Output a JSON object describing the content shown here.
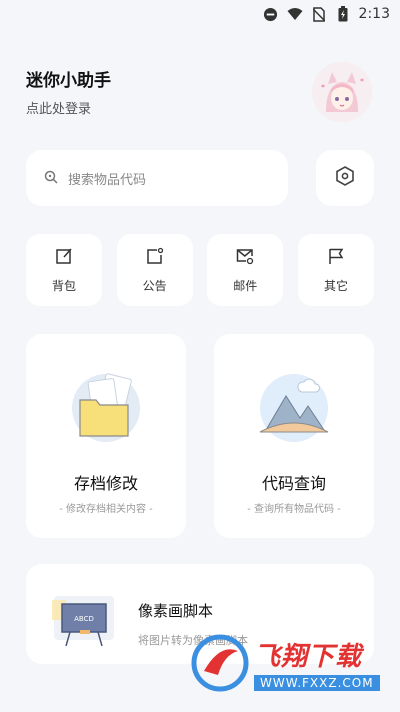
{
  "status_bar": {
    "time": "2:13"
  },
  "header": {
    "title": "迷你小助手",
    "login_text": "点此处登录"
  },
  "search": {
    "placeholder": "搜索物品代码"
  },
  "quick_actions": [
    {
      "label": "背包",
      "icon": "edit-icon"
    },
    {
      "label": "公告",
      "icon": "notice-icon"
    },
    {
      "label": "邮件",
      "icon": "mail-icon"
    },
    {
      "label": "其它",
      "icon": "flag-icon"
    }
  ],
  "cards": {
    "save_edit": {
      "title": "存档修改",
      "subtitle": "- 修改存档相关内容 -"
    },
    "code_query": {
      "title": "代码查询",
      "subtitle": "- 查询所有物品代码 -"
    },
    "pixel_script": {
      "title": "像素画脚本",
      "subtitle": "将图片转为像素画脚本",
      "board_text": "ABCD"
    }
  },
  "watermark": {
    "title": "飞翔下载",
    "url": "WWW.FXXZ.COM"
  },
  "colors": {
    "background": "#f5f6f9",
    "card": "#ffffff",
    "watermark_red": "#e23232",
    "watermark_blue": "#3a8fe0"
  }
}
